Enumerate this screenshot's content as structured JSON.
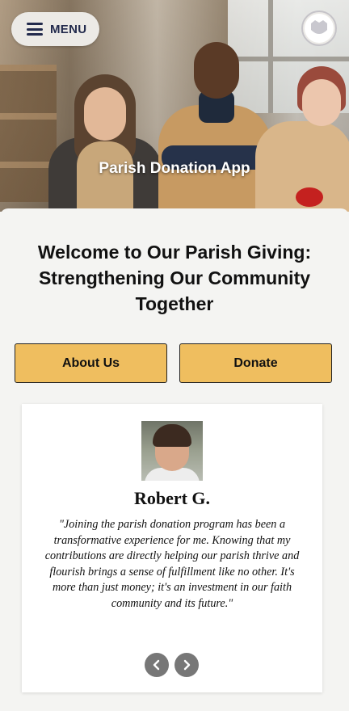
{
  "header": {
    "menu_label": "MENU",
    "hero_title": "Parish Donation App",
    "logo_icon": "church-logo-icon"
  },
  "main": {
    "headline": "Welcome to Our Parish Giving: Strengthening Our Community Together",
    "buttons": {
      "about_label": "About Us",
      "donate_label": "Donate"
    },
    "testimonial": {
      "name": "Robert G.",
      "quote": "\"Joining the parish donation program has been a transformative experience for me. Knowing that my contributions are directly helping our parish thrive and flourish brings a sense of fulfillment like no other. It's more than just money; it's an investment in our faith community and its future.\""
    }
  },
  "colors": {
    "accent": "#efbe5f",
    "navy": "#222a4c",
    "background": "#f4f4f2"
  }
}
